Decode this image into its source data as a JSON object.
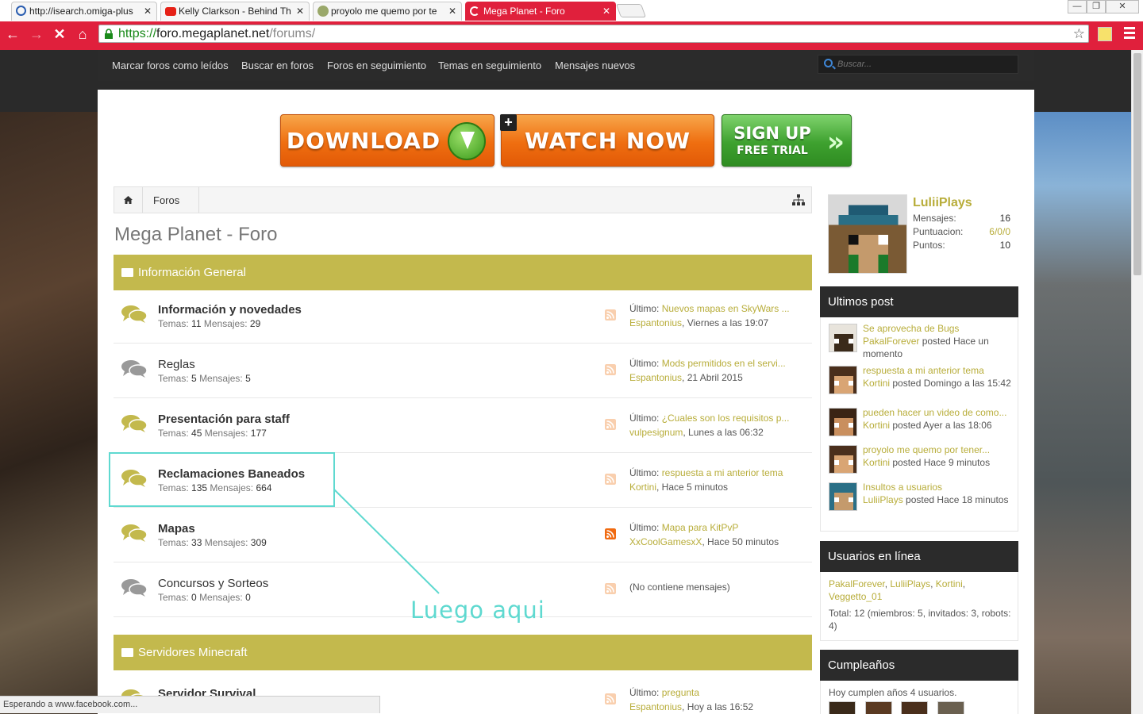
{
  "browser": {
    "tabs": [
      {
        "title": "http://isearch.omiga-plus",
        "icon": "globe-icon",
        "active": false
      },
      {
        "title": "Kelly Clarkson - Behind Th",
        "icon": "youtube-icon",
        "active": false
      },
      {
        "title": "proyolo me quemo por te",
        "icon": "forum-favicon",
        "active": false
      },
      {
        "title": "Mega Planet - Foro",
        "icon": "loading-spinner-icon",
        "active": true
      }
    ],
    "tab_close": "✕",
    "url": {
      "scheme": "https://",
      "host": "foro.megaplanet.net",
      "path": "/forums/"
    },
    "window_buttons": {
      "minimize": "—",
      "maximize": "❐",
      "close": "✕"
    },
    "nav": {
      "back": "←",
      "forward": "→",
      "stop": "✕",
      "home": "⌂"
    },
    "bookmark_star": "☆",
    "status_text": "Esperando a www.facebook.com..."
  },
  "topnav": {
    "links": [
      "Marcar foros como leídos",
      "Buscar en foros",
      "Foros en seguimiento",
      "Temas en seguimiento",
      "Mensajes nuevos"
    ],
    "search_placeholder": "Buscar..."
  },
  "banners": {
    "download": "DOWNLOAD",
    "watch": "WATCH NOW",
    "signup_top": "SIGN UP",
    "signup_bottom": "FREE TRIAL",
    "signup_chevron": "»",
    "plus": "+"
  },
  "breadcrumb": {
    "home_icon": "home-icon",
    "items": [
      "Foros"
    ]
  },
  "page_title": "Mega Planet - Foro",
  "categories": [
    {
      "title": "Información General",
      "forums": [
        {
          "name": "Información y novedades",
          "bold": true,
          "temas": "11",
          "mensajes": "29",
          "last_label": "Último:",
          "last_title": "Nuevos mapas en SkyWars ...",
          "last_user": "Espantonius",
          "last_time": ", Viernes a las 19:07",
          "has_new": true
        },
        {
          "name": "Reglas",
          "bold": false,
          "temas": "5",
          "mensajes": "5",
          "last_label": "Último:",
          "last_title": "Mods permitidos en el servi...",
          "last_user": "Espantonius",
          "last_time": ", 21 Abril 2015",
          "has_new": false
        },
        {
          "name": "Presentación para staff",
          "bold": true,
          "temas": "45",
          "mensajes": "177",
          "last_label": "Último:",
          "last_title": "¿Cuales son los requisitos p...",
          "last_user": "vulpesignum",
          "last_time": ", Lunes a las 06:32",
          "has_new": true
        },
        {
          "name": "Reclamaciones Baneados",
          "bold": true,
          "temas": "135",
          "mensajes": "664",
          "last_label": "Último:",
          "last_title": "respuesta a mi anterior tema",
          "last_user": "Kortini",
          "last_time": ", Hace 5 minutos",
          "has_new": true
        },
        {
          "name": "Mapas",
          "bold": true,
          "temas": "33",
          "mensajes": "309",
          "last_label": "Último:",
          "last_title": "Mapa para KitPvP",
          "last_user": "XxCoolGamesxX",
          "last_time": ", Hace 50 minutos",
          "has_new": true
        },
        {
          "name": "Concursos y Sorteos",
          "bold": false,
          "temas": "0",
          "mensajes": "0",
          "last_label": "(No contiene mensajes)",
          "last_title": "",
          "last_user": "",
          "last_time": "",
          "has_new": false
        }
      ]
    },
    {
      "title": "Servidores Minecraft",
      "forums": [
        {
          "name": "Servidor Survival",
          "bold": true,
          "temas": "",
          "mensajes": "",
          "last_label": "Último:",
          "last_title": "pregunta",
          "last_user": "Espantonius",
          "last_time": ", Hoy a las 16:52",
          "has_new": true
        }
      ]
    }
  ],
  "labels": {
    "temas": "Temas:",
    "mensajes": "Mensajes:"
  },
  "profile": {
    "name": "LuliiPlays",
    "rows": [
      {
        "label": "Mensajes:",
        "value": "16"
      },
      {
        "label": "Puntuacion:",
        "value": "6/0/0"
      },
      {
        "label": "Puntos:",
        "value": "10"
      }
    ]
  },
  "ultimos_post": {
    "title": "Ultimos post",
    "items": [
      {
        "title": "Se aprovecha de Bugs",
        "user": "PakalForever",
        "rest": " posted Hace un momento"
      },
      {
        "title": "respuesta a mi anterior tema",
        "user": "Kortini",
        "rest": " posted Domingo a las 15:42"
      },
      {
        "title": "pueden hacer un video de como...",
        "user": "Kortini",
        "rest": " posted Ayer a las 18:06"
      },
      {
        "title": "proyolo me quemo por tener...",
        "user": "Kortini",
        "rest": " posted Hace 9 minutos"
      },
      {
        "title": "Insultos a usuarios",
        "user": "LuliiPlays",
        "rest": " posted Hace 18 minutos"
      }
    ]
  },
  "online": {
    "title": "Usuarios en línea",
    "users": [
      "PakalForever",
      "LuliiPlays",
      "Kortini",
      "Veggetto_01"
    ],
    "total": "Total: 12 (miembros: 5, invitados: 3, robots: 4)"
  },
  "birthdays": {
    "title": "Cumpleaños",
    "text": "Hoy cumplen años 4 usuarios."
  },
  "annotation": {
    "text": "Luego aqui",
    "color": "#5fd9d0"
  },
  "colors": {
    "accent": "#c3b94d",
    "link": "#b8ad3a",
    "chrome": "#e0203c",
    "dark": "#2b2b2b"
  }
}
